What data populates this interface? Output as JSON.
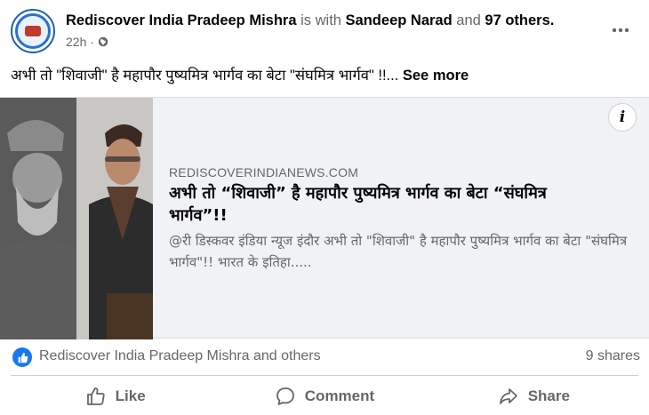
{
  "post": {
    "author": "Rediscover India Pradeep Mishra",
    "with_text": "is with",
    "tagged_person": "Sandeep Narad",
    "and_text": "and",
    "others": "97 others.",
    "time": "22h",
    "audience_icon": "globe-icon",
    "more_icon": "more-icon",
    "text": "अभी तो \"शिवाजी\" है महापौर पुष्यमित्र भार्गव का बेटा \"संघमित्र भार्गव\" !!...",
    "see_more": "See more"
  },
  "link_preview": {
    "info_label": "i",
    "domain": "REDISCOVERINDIANEWS.COM",
    "title": "अभी तो “शिवाजी” है महापौर पुष्यमित्र भार्गव का बेटा “संघमित्र भार्गव”!!",
    "description": "@री डिस्कवर इंडिया न्यूज इंदौर अभी तो \"शिवाजी\" है महापौर पुष्यमित्र भार्गव का बेटा \"संघमित्र भार्गव\"!! भारत के इतिहा....."
  },
  "stats": {
    "reaction_icon": "like-reaction-icon",
    "reactions_text": "Rediscover India Pradeep Mishra and others",
    "shares": "9 shares"
  },
  "actions": {
    "like": "Like",
    "comment": "Comment",
    "share": "Share"
  },
  "colors": {
    "accent": "#1877f2",
    "muted_text": "#65676b",
    "card_bg": "#f0f2f5"
  }
}
